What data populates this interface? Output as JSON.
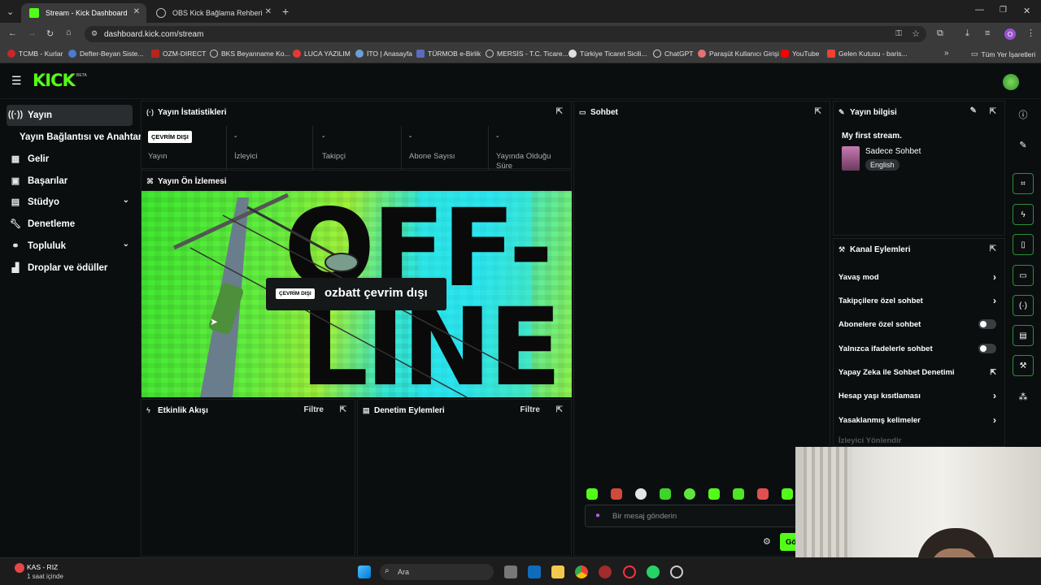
{
  "browser": {
    "tabs": [
      {
        "label": "Stream - Kick Dashboard",
        "active": true
      },
      {
        "label": "OBS Kick Bağlama Rehberi",
        "active": false
      }
    ],
    "url": "dashboard.kick.com/stream",
    "bookmarks": [
      "TCMB - Kurlar",
      "Defter-Beyan Siste...",
      "OZM-DIRECT",
      "BKS Beyanname Ko...",
      "LUCA YAZILIM",
      "İTO | Anasayfa",
      "TÜRMOB e-Birlik",
      "MERSİS - T.C. Ticare...",
      "Türkiye Ticaret Sicili...",
      "ChatGPT",
      "Paraşüt Kullanıcı Girişi",
      "YouTube",
      "Gelen Kutusu - baris..."
    ],
    "all_bookmarks": "Tüm Yer İşaretleri",
    "profile_initial": "O"
  },
  "app": {
    "logo": "KICK",
    "logo_badge": "BETA"
  },
  "sidebar": {
    "items": [
      {
        "label": "Yayın",
        "icon": "broadcast-icon"
      },
      {
        "label": "Yayın Bağlantısı ve Anahtarı"
      },
      {
        "label": "Gelir",
        "icon": "chart-icon"
      },
      {
        "label": "Başarılar",
        "icon": "trophy-icon"
      },
      {
        "label": "Stüdyo",
        "icon": "studio-icon"
      },
      {
        "label": "Denetleme",
        "icon": "wrench-icon"
      },
      {
        "label": "Topluluk",
        "icon": "community-icon"
      },
      {
        "label": "Droplar ve ödüller",
        "icon": "gift-icon"
      }
    ]
  },
  "stats": {
    "title": "Yayın İstatistikleri",
    "status_badge": "ÇEVRİM DIŞI",
    "items": [
      {
        "value": "",
        "label": "Yayın"
      },
      {
        "value": "-",
        "label": "İzleyici"
      },
      {
        "value": "-",
        "label": "Takipçi"
      },
      {
        "value": "-",
        "label": "Abone Sayısı"
      },
      {
        "value": "-",
        "label": "Yayında Olduğu Süre"
      }
    ]
  },
  "preview": {
    "title": "Yayın Ön İzlemesi",
    "badge": "ÇEVRİM DIŞI",
    "offline_text": "ozbatt çevrim dışı",
    "art_line1": "OFF-",
    "art_line2": "LINE"
  },
  "activity": {
    "title": "Etkinlik Akışı",
    "filter": "Filtre"
  },
  "moderation": {
    "title": "Denetim Eylemleri",
    "filter": "Filtre"
  },
  "chat": {
    "title": "Sohbet",
    "placeholder": "Bir mesaj gönderin",
    "send": "Gö"
  },
  "stream_info": {
    "title": "Yayın bilgisi",
    "stream_title": "My first stream.",
    "category": "Sadece Sohbet",
    "language": "English"
  },
  "channel_actions": {
    "title": "Kanal Eylemleri",
    "items": [
      {
        "label": "Yavaş mod",
        "control": "arrow"
      },
      {
        "label": "Takipçilere özel sohbet",
        "control": "arrow"
      },
      {
        "label": "Abonelere özel sohbet",
        "control": "toggle"
      },
      {
        "label": "Yalnızca ifadelerle sohbet",
        "control": "toggle"
      },
      {
        "label": "Yapay Zeka ile Sohbet Denetimi",
        "control": "external"
      },
      {
        "label": "Hesap yaşı kısıtlaması",
        "control": "arrow"
      },
      {
        "label": "Yasaklanmış kelimeler",
        "control": "arrow"
      }
    ],
    "faded_item": "İzleyici Yönlendir"
  },
  "taskbar": {
    "weather_label": "KAS - RIZ",
    "weather_sub": "1 saat içinde",
    "search": "Ara"
  },
  "colors": {
    "kick_green": "#53fc18",
    "background": "#0b0e0f",
    "panel_border": "#1d2022"
  }
}
